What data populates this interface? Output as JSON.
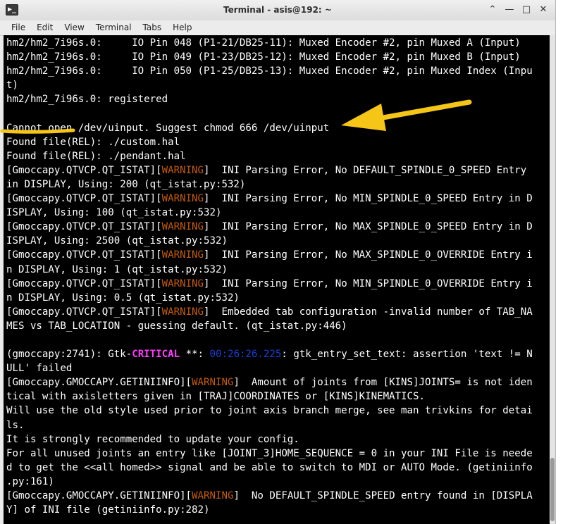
{
  "window": {
    "title": "Terminal - asis@192: ~",
    "icon_glyph": "▶_",
    "controls": {
      "up": "⌃",
      "minimize": "—",
      "maximize": "□",
      "close": "✕"
    }
  },
  "menu": [
    "File",
    "Edit",
    "View",
    "Terminal",
    "Tabs",
    "Help"
  ],
  "terminal_lines": [
    [
      {
        "t": "hm2/hm2_7i96s.0:     IO Pin 048 (P1-21/DB25-11): Muxed Encoder #2, pin Muxed A (Input)"
      }
    ],
    [
      {
        "t": "hm2/hm2_7i96s.0:     IO Pin 049 (P1-23/DB25-12): Muxed Encoder #2, pin Muxed B (Input)"
      }
    ],
    [
      {
        "t": "hm2/hm2_7i96s.0:     IO Pin 050 (P1-25/DB25-13): Muxed Encoder #2, pin Muxed Index (Inpu"
      }
    ],
    [
      {
        "t": "t)"
      }
    ],
    [
      {
        "t": "hm2/hm2_7i96s.0: registered"
      }
    ],
    [
      {
        "t": ""
      }
    ],
    [
      {
        "t": "Cannot open /dev/uinput. Suggest chmod 666 /dev/uinput"
      }
    ],
    [
      {
        "t": "Found file(REL): ./custom.hal"
      }
    ],
    [
      {
        "t": "Found file(REL): ./pendant.hal"
      }
    ],
    [
      {
        "t": "[Gmoccapy.QTVCP.QT_ISTAT]["
      },
      {
        "t": "WARNING",
        "c": "warn"
      },
      {
        "t": "]  INI Parsing Error, No DEFAULT_SPINDLE_0_SPEED Entry"
      }
    ],
    [
      {
        "t": "in DISPLAY, Using: 200 (qt_istat.py:532)"
      }
    ],
    [
      {
        "t": "[Gmoccapy.QTVCP.QT_ISTAT]["
      },
      {
        "t": "WARNING",
        "c": "warn"
      },
      {
        "t": "]  INI Parsing Error, No MIN_SPINDLE_0_SPEED Entry in D"
      }
    ],
    [
      {
        "t": "ISPLAY, Using: 100 (qt_istat.py:532)"
      }
    ],
    [
      {
        "t": "[Gmoccapy.QTVCP.QT_ISTAT]["
      },
      {
        "t": "WARNING",
        "c": "warn"
      },
      {
        "t": "]  INI Parsing Error, No MAX_SPINDLE_0_SPEED Entry in D"
      }
    ],
    [
      {
        "t": "ISPLAY, Using: 2500 (qt_istat.py:532)"
      }
    ],
    [
      {
        "t": "[Gmoccapy.QTVCP.QT_ISTAT]["
      },
      {
        "t": "WARNING",
        "c": "warn"
      },
      {
        "t": "]  INI Parsing Error, No MAX_SPINDLE_0_OVERRIDE Entry i"
      }
    ],
    [
      {
        "t": "n DISPLAY, Using: 1 (qt_istat.py:532)"
      }
    ],
    [
      {
        "t": "[Gmoccapy.QTVCP.QT_ISTAT]["
      },
      {
        "t": "WARNING",
        "c": "warn"
      },
      {
        "t": "]  INI Parsing Error, No MIN_SPINDLE_0_OVERRIDE Entry i"
      }
    ],
    [
      {
        "t": "n DISPLAY, Using: 0.5 (qt_istat.py:532)"
      }
    ],
    [
      {
        "t": "[Gmoccapy.QTVCP.QT_ISTAT]["
      },
      {
        "t": "WARNING",
        "c": "warn"
      },
      {
        "t": "]  Embedded tab configuration -invalid number of TAB_NA"
      }
    ],
    [
      {
        "t": "MES vs TAB_LOCATION - guessing default. (qt_istat.py:446)"
      }
    ],
    [
      {
        "t": ""
      }
    ],
    [
      {
        "t": "(gmoccapy:2741): Gtk-"
      },
      {
        "t": "CRITICAL",
        "c": "crit"
      },
      {
        "t": " **: "
      },
      {
        "t": "00:26:26.225",
        "c": "ts"
      },
      {
        "t": ": gtk_entry_set_text: assertion 'text != N"
      }
    ],
    [
      {
        "t": "ULL' failed"
      }
    ],
    [
      {
        "t": "[Gmoccapy.GMOCCAPY.GETINIINFO]["
      },
      {
        "t": "WARNING",
        "c": "warn"
      },
      {
        "t": "]  Amount of joints from [KINS]JOINTS= is not iden"
      }
    ],
    [
      {
        "t": "tical with axisletters given in [TRAJ]COORDINATES or [KINS]KINEMATICS."
      }
    ],
    [
      {
        "t": "Will use the old style used prior to joint axis branch merge, see man trivkins for detai"
      }
    ],
    [
      {
        "t": "ls."
      }
    ],
    [
      {
        "t": "It is strongly recommended to update your config."
      }
    ],
    [
      {
        "t": "For all unused joints an entry like [JOINT_3]HOME_SEQUENCE = 0 in your INI File is neede"
      }
    ],
    [
      {
        "t": "d to get the <<all homed>> signal and be able to switch to MDI or AUTO Mode. (getiniinfo"
      }
    ],
    [
      {
        "t": ".py:161)"
      }
    ],
    [
      {
        "t": "[Gmoccapy.GMOCCAPY.GETINIINFO]["
      },
      {
        "t": "WARNING",
        "c": "warn"
      },
      {
        "t": "]  No DEFAULT_SPINDLE_SPEED entry found in [DISPLA"
      }
    ],
    [
      {
        "t": "Y] of INI file (getiniinfo.py:282)"
      }
    ]
  ],
  "annotation": {
    "color": "#f5c518"
  }
}
